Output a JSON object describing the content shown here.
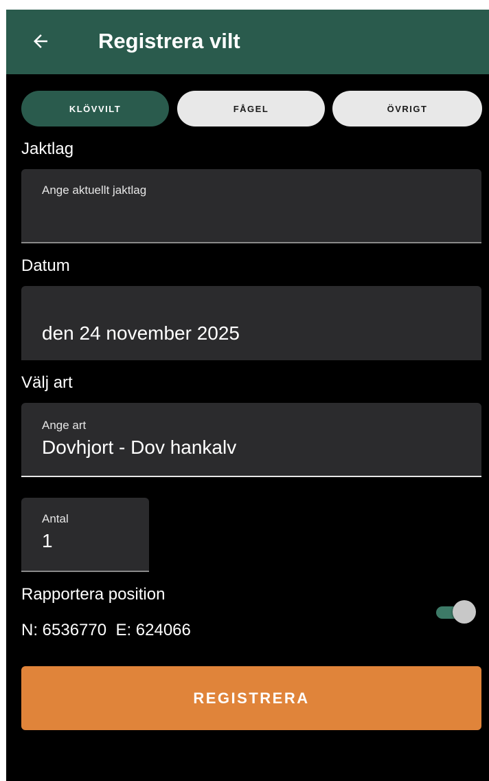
{
  "appbar": {
    "title": "Registrera vilt",
    "back_icon": "arrow-left-icon",
    "background": "#2a5b4d"
  },
  "tabs": [
    {
      "label": "KLÖVVILT",
      "active": true
    },
    {
      "label": "FÅGEL",
      "active": false
    },
    {
      "label": "ÖVRIGT",
      "active": false
    }
  ],
  "form": {
    "jaktlag": {
      "label": "Jaktlag",
      "placeholder": "Ange aktuellt jaktlag",
      "value": ""
    },
    "datum": {
      "label": "Datum",
      "value": "den 24 november 2025"
    },
    "art": {
      "label": "Välj art",
      "hint": "Ange art",
      "value": "Dovhjort - Dov hankalv"
    },
    "antal": {
      "hint": "Antal",
      "value": "1"
    }
  },
  "position": {
    "label": "Rapportera position",
    "coordinates": "N: 6536770  E: 624066",
    "enabled": true
  },
  "submit": {
    "label": "REGISTRERA",
    "color": "#e0843a"
  }
}
